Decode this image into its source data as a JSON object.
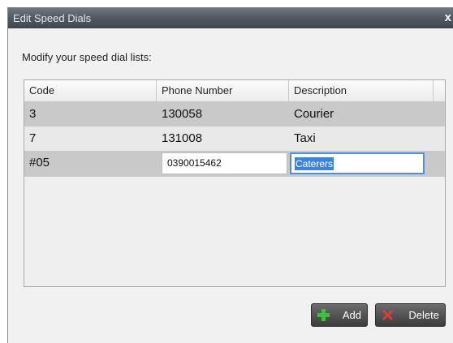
{
  "window": {
    "title": "Edit Speed Dials",
    "close_glyph": "x"
  },
  "prompt": "Modify your speed dial lists:",
  "table": {
    "columns": [
      "Code",
      "Phone Number",
      "Description"
    ],
    "rows": [
      {
        "code": "3",
        "phone": "130058",
        "description": "Courier"
      },
      {
        "code": "7",
        "phone": "131008",
        "description": "Taxi"
      }
    ],
    "edit_row": {
      "code": "#05",
      "phone": "0390015462",
      "description": "Caterers"
    }
  },
  "buttons": {
    "add": "Add",
    "delete": "Delete"
  },
  "icons": {
    "add": "plus-icon",
    "delete": "x-icon",
    "close": "close-icon"
  },
  "colors": {
    "titlebar": "#545d63",
    "add_icon": "#3fbf3f",
    "delete_icon": "#e23a3a",
    "selection": "#3b83e0"
  }
}
